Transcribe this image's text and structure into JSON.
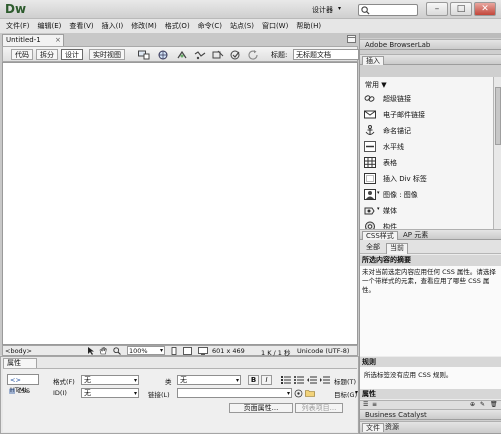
{
  "app": {
    "logo": "Dw",
    "workspace": "设计器",
    "workspace_arrow": "▾",
    "search_placeholder": ""
  },
  "window_buttons": {
    "minimize": "–",
    "maximize": "□",
    "close": "✕"
  },
  "menu": [
    "文件(F)",
    "编辑(E)",
    "查看(V)",
    "插入(I)",
    "修改(M)",
    "格式(O)",
    "命令(C)",
    "站点(S)",
    "窗口(W)",
    "帮助(H)"
  ],
  "document": {
    "tab_name": "Untitled-1",
    "tab_close": "×",
    "view_buttons": [
      "代码",
      "拆分",
      "设计",
      "实时视图"
    ],
    "active_view": "设计",
    "title_label": "标题:",
    "title_value": "无标题文档"
  },
  "status_bar": {
    "tag": "<body>",
    "zoom": "100%",
    "dimensions": "601 x 469",
    "size": "1 K / 1 秒",
    "encoding": "Unicode (UTF-8)"
  },
  "properties": {
    "tab": "属性",
    "html_toggle": "HTML",
    "css_toggle": "CSS",
    "format_label": "格式(F)",
    "format_value": "无",
    "class_label": "类",
    "class_value": "无",
    "id_label": "ID(I)",
    "id_value": "无",
    "link_label": "链接(L)",
    "link_value": "",
    "bold": "B",
    "italic": "I",
    "title_label": "标题(T)",
    "target_label": "目标(G)",
    "page_props_button": "页面属性...",
    "list_item_button": "列表项目..."
  },
  "panels": {
    "browserlab_title": "Adobe BrowserLab",
    "insert_tab": "插入",
    "insert_category": "常用",
    "insert_items": [
      {
        "label": "超级链接",
        "icon": "hyperlink-icon"
      },
      {
        "label": "电子邮件链接",
        "icon": "email-link-icon"
      },
      {
        "label": "命名锚记",
        "icon": "named-anchor-icon"
      },
      {
        "label": "水平线",
        "icon": "horizontal-rule-icon"
      },
      {
        "label": "表格",
        "icon": "table-icon"
      },
      {
        "label": "插入 Div 标签",
        "icon": "div-tag-icon"
      },
      {
        "label": "图像 : 图像",
        "icon": "image-icon"
      },
      {
        "label": "媒体",
        "icon": "media-icon"
      },
      {
        "label": "构件",
        "icon": "widget-icon"
      }
    ],
    "css_tabs": [
      "CSS样式",
      "AP 元素"
    ],
    "css_modes": [
      "全部",
      "当前"
    ],
    "css_active_mode": "当前",
    "summary_title": "所选内容的摘要",
    "summary_text": "未对当前选定内容应用任何 CSS 属性。请选择一个带样式的元素，查看应用了哪些 CSS 属性。",
    "rules_title": "规则",
    "rules_text": "所选标签没有应用 CSS 规则。",
    "attributes_title": "属性",
    "business_catalyst": "Business Catalyst",
    "files_tabs": [
      "文件",
      "资源"
    ]
  }
}
